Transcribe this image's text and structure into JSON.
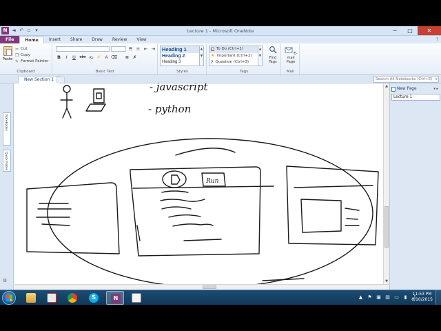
{
  "window": {
    "title": "Lecture 1 - Microsoft OneNote",
    "qat_icons": [
      "onenote-logo-icon",
      "back-icon",
      "undo-icon",
      "dock-icon",
      "customize-icon"
    ],
    "controls": {
      "minimize": "─",
      "maximize": "□",
      "close": "✕"
    }
  },
  "ribbon_tabs": [
    "File",
    "Home",
    "Insert",
    "Share",
    "Draw",
    "Review",
    "View"
  ],
  "active_tab": "Home",
  "clipboard": {
    "paste": "Paste",
    "cut": "Cut",
    "copy": "Copy",
    "format_painter": "Format Painter",
    "group_label": "Clipboard"
  },
  "basic_text": {
    "bold": "B",
    "italic": "I",
    "underline": "U",
    "strike": "abc",
    "group_label": "Basic Text"
  },
  "styles": {
    "items": [
      "Heading 1",
      "Heading 2",
      "Heading 3"
    ],
    "group_label": "Styles"
  },
  "tags": {
    "items": [
      "To Do (Ctrl+1)",
      "Important (Ctrl+2)",
      "Question (Ctrl+3)"
    ],
    "find_tags": "Find Tags",
    "group_label": "Tags"
  },
  "mail": {
    "email_page": "E-mail Page",
    "group_label": "Mail"
  },
  "section_tab": "New Section 1",
  "search": {
    "placeholder": "Search All Notebooks (Ctrl+E)"
  },
  "left_nav": [
    "Notebooks",
    "Quick Notes"
  ],
  "page_pane": {
    "new_page": "New Page",
    "pages": [
      "Lecture 1"
    ]
  },
  "canvas": {
    "ink_text": [
      "- javascript",
      "- python",
      "Run"
    ],
    "ink_color": "#1a1a1a"
  },
  "taskbar": {
    "apps": [
      "explorer",
      "snipping",
      "chrome",
      "skype",
      "onenote",
      "file-viewer"
    ],
    "active_app": "onenote",
    "time": "11:53 PM",
    "date": "6/10/2015"
  },
  "colors": {
    "onenote_purple": "#80397b",
    "ribbon_blue": "#dde9f7",
    "taskbar": "#1c4c75"
  }
}
